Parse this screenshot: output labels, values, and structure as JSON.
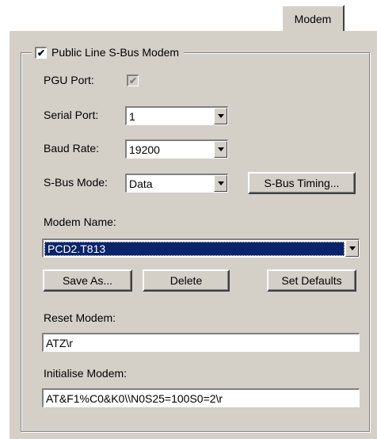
{
  "tab": {
    "label": "Modem"
  },
  "group": {
    "title": "Public Line S-Bus Modem",
    "checked": "✔"
  },
  "pgu_port": {
    "label": "PGU Port:",
    "checked": "✔"
  },
  "serial_port": {
    "label": "Serial Port:",
    "value": "1"
  },
  "baud_rate": {
    "label": "Baud Rate:",
    "value": "19200"
  },
  "sbus_mode": {
    "label": "S-Bus Mode:",
    "value": "Data"
  },
  "buttons": {
    "sbus_timing": "S-Bus Timing...",
    "save_as": "Save As...",
    "delete": "Delete",
    "set_defaults": "Set Defaults"
  },
  "modem_name": {
    "label": "Modem Name:",
    "value": "PCD2.T813"
  },
  "reset_modem": {
    "label": "Reset Modem:",
    "value": "ATZ\\r"
  },
  "initialise_modem": {
    "label": "Initialise Modem:",
    "value": "AT&F1%C0&K0\\\\N0S25=100S0=2\\r"
  }
}
